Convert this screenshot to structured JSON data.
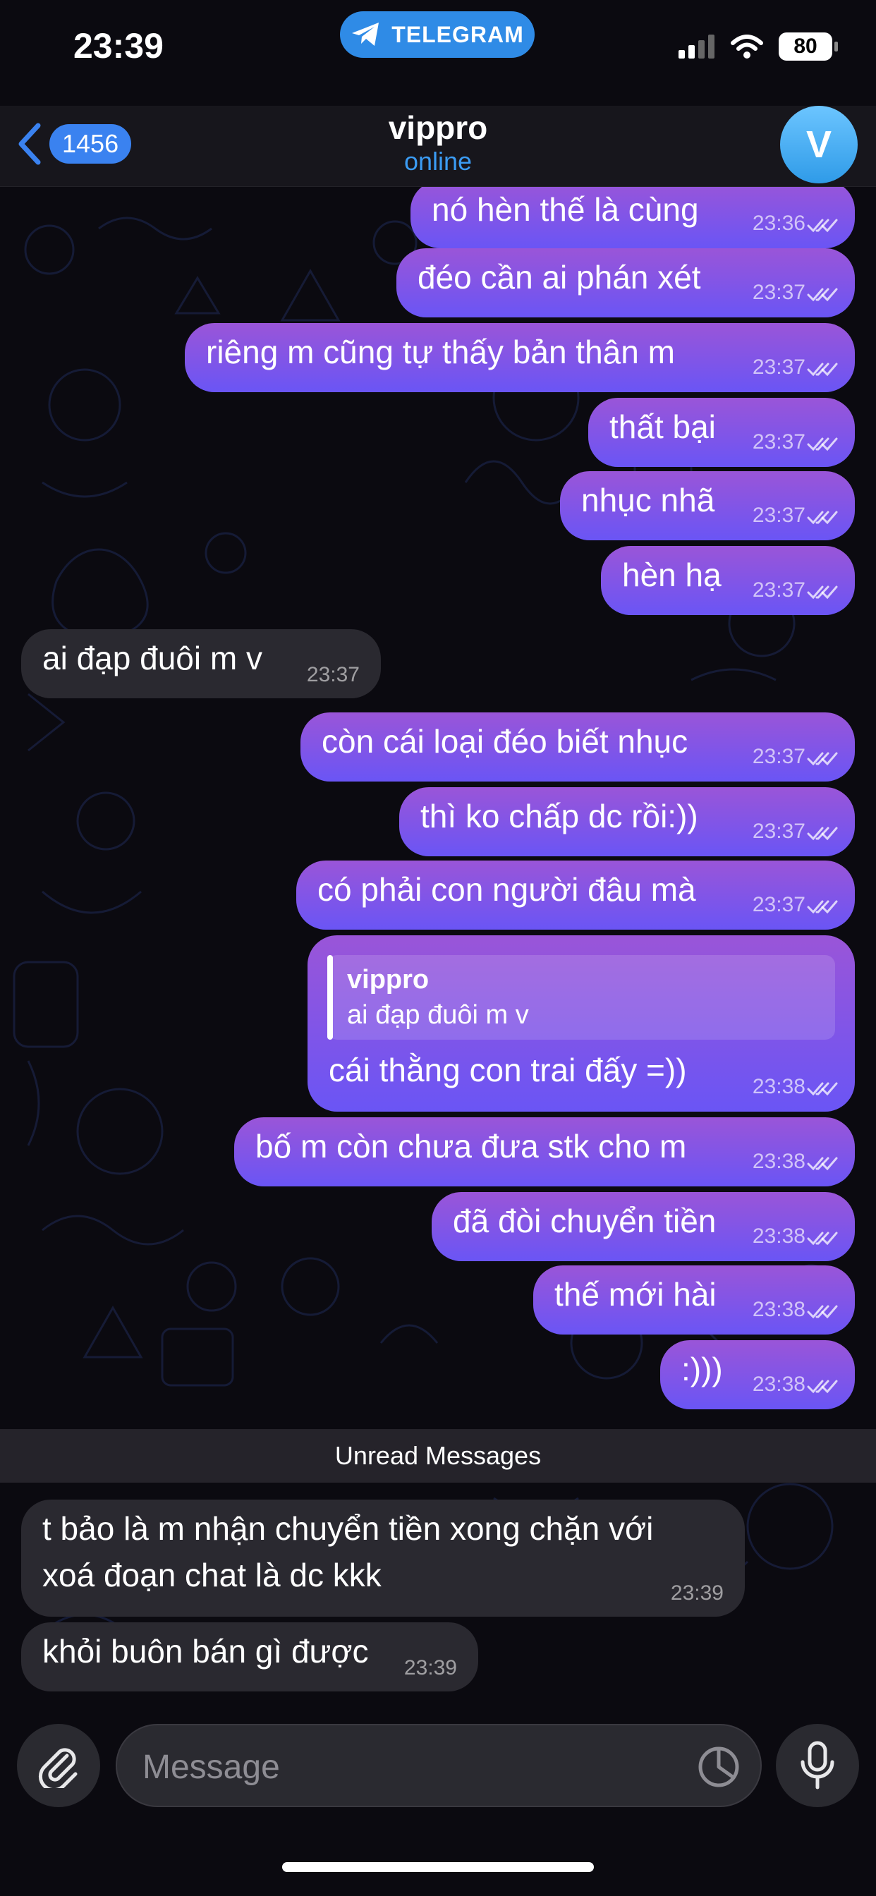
{
  "status_bar": {
    "time": "23:39",
    "app_label": "TELEGRAM",
    "battery": "80"
  },
  "header": {
    "back_count": "1456",
    "title": "vippro",
    "subtitle": "online",
    "avatar_letter": "V"
  },
  "messages": [
    {
      "dir": "out",
      "text": "nó hèn thế là cùng",
      "time": "23:36",
      "read": true
    },
    {
      "dir": "out",
      "text": "đéo cần ai phán xét",
      "time": "23:37",
      "read": true
    },
    {
      "dir": "out",
      "text": "riêng m cũng tự thấy bản thân m",
      "time": "23:37",
      "read": true
    },
    {
      "dir": "out",
      "text": "thất bại",
      "time": "23:37",
      "read": true
    },
    {
      "dir": "out",
      "text": "nhục nhã",
      "time": "23:37",
      "read": true
    },
    {
      "dir": "out",
      "text": "hèn hạ",
      "time": "23:37",
      "read": true
    },
    {
      "dir": "in",
      "text": "ai đạp đuôi m v",
      "time": "23:37"
    },
    {
      "dir": "out",
      "text": "còn cái loại đéo biết nhục",
      "time": "23:37",
      "read": true
    },
    {
      "dir": "out",
      "text": "thì ko chấp dc rồi:))",
      "time": "23:37",
      "read": true
    },
    {
      "dir": "out",
      "text": "có phải con người đâu mà",
      "time": "23:37",
      "read": true
    },
    {
      "dir": "out",
      "text": "cái thằng con trai đấy =))",
      "time": "23:38",
      "read": true,
      "reply": {
        "name": "vippro",
        "text": "ai đạp đuôi m v"
      }
    },
    {
      "dir": "out",
      "text": "bố m còn chưa đưa stk cho m",
      "time": "23:38",
      "read": true
    },
    {
      "dir": "out",
      "text": "đã đòi chuyển tiền",
      "time": "23:38",
      "read": true
    },
    {
      "dir": "out",
      "text": "thế mới hài",
      "time": "23:38",
      "read": true
    },
    {
      "dir": "out",
      "text": ":)))",
      "time": "23:38",
      "read": true
    }
  ],
  "unread_label": "Unread Messages",
  "incoming_after": [
    {
      "dir": "in",
      "lines": [
        "t bảo là m nhận chuyển tiền xong chặn với",
        "xoá đoạn chat là dc kkk"
      ],
      "time": "23:39"
    },
    {
      "dir": "in",
      "text": "khỏi buôn bán gì được",
      "time": "23:39"
    }
  ],
  "composer": {
    "placeholder": "Message"
  },
  "colors": {
    "bubble_top": "#9a55d8",
    "bubble_bottom": "#6a55f5",
    "incoming": "#2a2930",
    "accent": "#3a82f0"
  },
  "icons": [
    "telegram-plane-icon",
    "signal-icon",
    "wifi-icon",
    "battery-icon",
    "back-chevron-icon",
    "read-checks-icon",
    "paperclip-icon",
    "sticker-icon",
    "microphone-icon"
  ]
}
